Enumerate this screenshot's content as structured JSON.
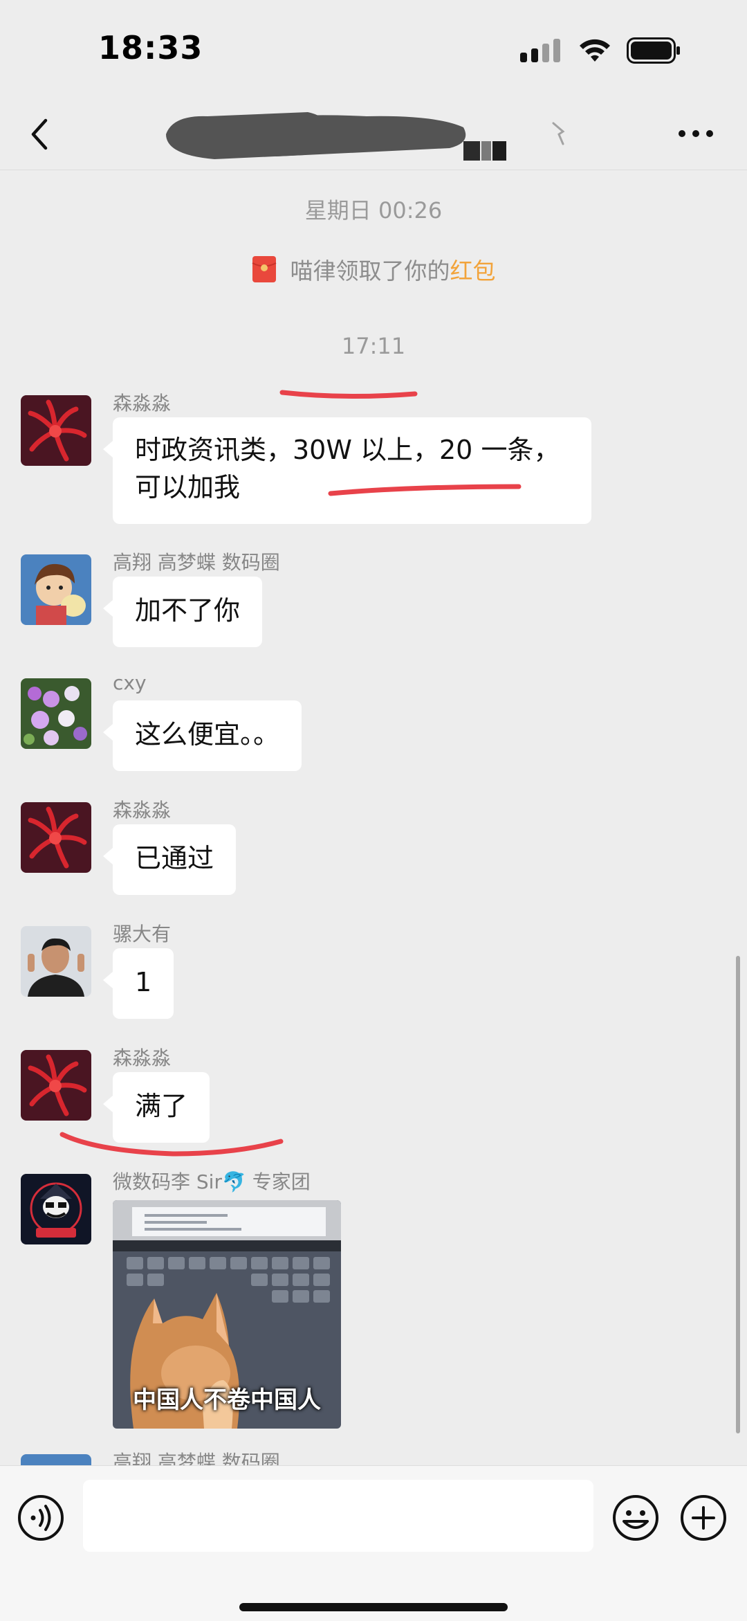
{
  "status_bar": {
    "time": "18:33"
  },
  "header": {
    "back_icon": "chevron-left-icon",
    "more_icon": "more-horizontal-icon"
  },
  "chat": {
    "system_time_1": "星期日 00:26",
    "red_packet_notice": {
      "prefix": "喵律领取了你的",
      "link": "红包",
      "icon": "red-packet-icon"
    },
    "system_time_2": "17:11",
    "messages": [
      {
        "sender": "森淼淼",
        "text_lines": [
          "时政资讯类，30W 以上，20 一条，",
          "可以加我"
        ]
      },
      {
        "sender": "高翔 高梦蝶 数码圈",
        "text": "加不了你"
      },
      {
        "sender": "cxy",
        "text": "这么便宜。。"
      },
      {
        "sender": "森淼淼",
        "text": "已通过"
      },
      {
        "sender": "骡大有",
        "text": "1"
      },
      {
        "sender": "森淼淼",
        "text": "满了"
      },
      {
        "sender": "微数码李 Sir🐬 专家团",
        "image_caption": "中国人不卷中国人"
      },
      {
        "sender": "高翔 高梦蝶 数码圈"
      }
    ],
    "annotation_color": "#e8424a"
  },
  "input_bar": {
    "placeholder": "",
    "voice_icon": "voice-icon",
    "emoji_icon": "emoji-icon",
    "plus_icon": "plus-circle-icon"
  }
}
